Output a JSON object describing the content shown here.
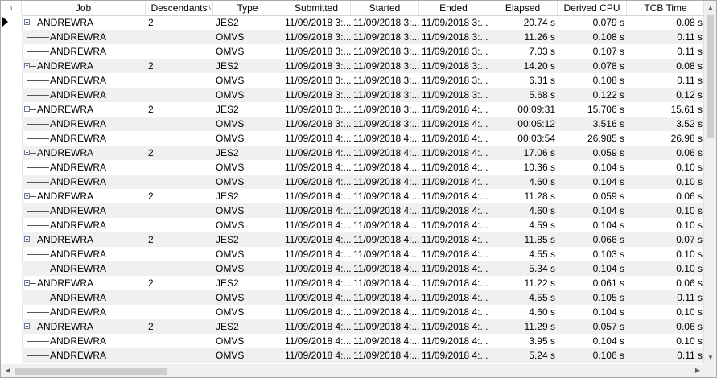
{
  "columns": [
    {
      "key": "pin",
      "label": "",
      "w": 26
    },
    {
      "key": "job",
      "label": "Job",
      "w": 154
    },
    {
      "key": "desc",
      "label": "Descendants",
      "w": 84
    },
    {
      "key": "type",
      "label": "Type",
      "w": 86
    },
    {
      "key": "submitted",
      "label": "Submitted",
      "w": 85
    },
    {
      "key": "started",
      "label": "Started",
      "w": 85
    },
    {
      "key": "ended",
      "label": "Ended",
      "w": 86
    },
    {
      "key": "elapsed",
      "label": "Elapsed",
      "w": 86
    },
    {
      "key": "cpu",
      "label": "Derived CPU",
      "w": 86
    },
    {
      "key": "tcb",
      "label": "TCB Time",
      "w": 97
    }
  ],
  "header_sort_indicator": "\\",
  "header_pin_glyph": "ᵖ",
  "rows": [
    {
      "level": 0,
      "job": "ANDREWRA",
      "desc": "2",
      "type": "JES2",
      "submitted": "11/09/2018  3:...",
      "started": "11/09/2018  3:...",
      "ended": "11/09/2018  3:...",
      "elapsed": "20.74 s",
      "cpu": "0.079 s",
      "tcb": "0.08 s"
    },
    {
      "level": 1,
      "job": "ANDREWRA",
      "desc": "",
      "type": "OMVS",
      "submitted": "11/09/2018  3:...",
      "started": "11/09/2018  3:...",
      "ended": "11/09/2018  3:...",
      "elapsed": "11.26 s",
      "cpu": "0.108 s",
      "tcb": "0.11 s"
    },
    {
      "level": 2,
      "job": "ANDREWRA",
      "desc": "",
      "type": "OMVS",
      "submitted": "11/09/2018  3:...",
      "started": "11/09/2018  3:...",
      "ended": "11/09/2018  3:...",
      "elapsed": "7.03 s",
      "cpu": "0.107 s",
      "tcb": "0.11 s"
    },
    {
      "level": 0,
      "job": "ANDREWRA",
      "desc": "2",
      "type": "JES2",
      "submitted": "11/09/2018  3:...",
      "started": "11/09/2018  3:...",
      "ended": "11/09/2018  3:...",
      "elapsed": "14.20 s",
      "cpu": "0.078 s",
      "tcb": "0.08 s"
    },
    {
      "level": 1,
      "job": "ANDREWRA",
      "desc": "",
      "type": "OMVS",
      "submitted": "11/09/2018  3:...",
      "started": "11/09/2018  3:...",
      "ended": "11/09/2018  3:...",
      "elapsed": "6.31 s",
      "cpu": "0.108 s",
      "tcb": "0.11 s"
    },
    {
      "level": 2,
      "job": "ANDREWRA",
      "desc": "",
      "type": "OMVS",
      "submitted": "11/09/2018  3:...",
      "started": "11/09/2018  3:...",
      "ended": "11/09/2018  3:...",
      "elapsed": "5.68 s",
      "cpu": "0.122 s",
      "tcb": "0.12 s"
    },
    {
      "level": 0,
      "job": "ANDREWRA",
      "desc": "2",
      "type": "JES2",
      "submitted": "11/09/2018  3:...",
      "started": "11/09/2018  3:...",
      "ended": "11/09/2018  4:...",
      "elapsed": "00:09:31",
      "cpu": "15.706 s",
      "tcb": "15.61 s"
    },
    {
      "level": 1,
      "job": "ANDREWRA",
      "desc": "",
      "type": "OMVS",
      "submitted": "11/09/2018  3:...",
      "started": "11/09/2018  3:...",
      "ended": "11/09/2018  4:...",
      "elapsed": "00:05:12",
      "cpu": "3.516 s",
      "tcb": "3.52 s"
    },
    {
      "level": 2,
      "job": "ANDREWRA",
      "desc": "",
      "type": "OMVS",
      "submitted": "11/09/2018  4:...",
      "started": "11/09/2018  4:...",
      "ended": "11/09/2018  4:...",
      "elapsed": "00:03:54",
      "cpu": "26.985 s",
      "tcb": "26.98 s"
    },
    {
      "level": 0,
      "job": "ANDREWRA",
      "desc": "2",
      "type": "JES2",
      "submitted": "11/09/2018  4:...",
      "started": "11/09/2018  4:...",
      "ended": "11/09/2018  4:...",
      "elapsed": "17.06 s",
      "cpu": "0.059 s",
      "tcb": "0.06 s"
    },
    {
      "level": 1,
      "job": "ANDREWRA",
      "desc": "",
      "type": "OMVS",
      "submitted": "11/09/2018  4:...",
      "started": "11/09/2018  4:...",
      "ended": "11/09/2018  4:...",
      "elapsed": "10.36 s",
      "cpu": "0.104 s",
      "tcb": "0.10 s"
    },
    {
      "level": 2,
      "job": "ANDREWRA",
      "desc": "",
      "type": "OMVS",
      "submitted": "11/09/2018  4:...",
      "started": "11/09/2018  4:...",
      "ended": "11/09/2018  4:...",
      "elapsed": "4.60 s",
      "cpu": "0.104 s",
      "tcb": "0.10 s"
    },
    {
      "level": 0,
      "job": "ANDREWRA",
      "desc": "2",
      "type": "JES2",
      "submitted": "11/09/2018  4:...",
      "started": "11/09/2018  4:...",
      "ended": "11/09/2018  4:...",
      "elapsed": "11.28 s",
      "cpu": "0.059 s",
      "tcb": "0.06 s"
    },
    {
      "level": 1,
      "job": "ANDREWRA",
      "desc": "",
      "type": "OMVS",
      "submitted": "11/09/2018  4:...",
      "started": "11/09/2018  4:...",
      "ended": "11/09/2018  4:...",
      "elapsed": "4.60 s",
      "cpu": "0.104 s",
      "tcb": "0.10 s"
    },
    {
      "level": 2,
      "job": "ANDREWRA",
      "desc": "",
      "type": "OMVS",
      "submitted": "11/09/2018  4:...",
      "started": "11/09/2018  4:...",
      "ended": "11/09/2018  4:...",
      "elapsed": "4.59 s",
      "cpu": "0.104 s",
      "tcb": "0.10 s"
    },
    {
      "level": 0,
      "job": "ANDREWRA",
      "desc": "2",
      "type": "JES2",
      "submitted": "11/09/2018  4:...",
      "started": "11/09/2018  4:...",
      "ended": "11/09/2018  4:...",
      "elapsed": "11.85 s",
      "cpu": "0.066 s",
      "tcb": "0.07 s"
    },
    {
      "level": 1,
      "job": "ANDREWRA",
      "desc": "",
      "type": "OMVS",
      "submitted": "11/09/2018  4:...",
      "started": "11/09/2018  4:...",
      "ended": "11/09/2018  4:...",
      "elapsed": "4.55 s",
      "cpu": "0.103 s",
      "tcb": "0.10 s"
    },
    {
      "level": 2,
      "job": "ANDREWRA",
      "desc": "",
      "type": "OMVS",
      "submitted": "11/09/2018  4:...",
      "started": "11/09/2018  4:...",
      "ended": "11/09/2018  4:...",
      "elapsed": "5.34 s",
      "cpu": "0.104 s",
      "tcb": "0.10 s"
    },
    {
      "level": 0,
      "job": "ANDREWRA",
      "desc": "2",
      "type": "JES2",
      "submitted": "11/09/2018  4:...",
      "started": "11/09/2018  4:...",
      "ended": "11/09/2018  4:...",
      "elapsed": "11.22 s",
      "cpu": "0.061 s",
      "tcb": "0.06 s"
    },
    {
      "level": 1,
      "job": "ANDREWRA",
      "desc": "",
      "type": "OMVS",
      "submitted": "11/09/2018  4:...",
      "started": "11/09/2018  4:...",
      "ended": "11/09/2018  4:...",
      "elapsed": "4.55 s",
      "cpu": "0.105 s",
      "tcb": "0.11 s"
    },
    {
      "level": 2,
      "job": "ANDREWRA",
      "desc": "",
      "type": "OMVS",
      "submitted": "11/09/2018  4:...",
      "started": "11/09/2018  4:...",
      "ended": "11/09/2018  4:...",
      "elapsed": "4.60 s",
      "cpu": "0.104 s",
      "tcb": "0.10 s"
    },
    {
      "level": 0,
      "job": "ANDREWRA",
      "desc": "2",
      "type": "JES2",
      "submitted": "11/09/2018  4:...",
      "started": "11/09/2018  4:...",
      "ended": "11/09/2018  4:...",
      "elapsed": "11.29 s",
      "cpu": "0.057 s",
      "tcb": "0.06 s"
    },
    {
      "level": 1,
      "job": "ANDREWRA",
      "desc": "",
      "type": "OMVS",
      "submitted": "11/09/2018  4:...",
      "started": "11/09/2018  4:...",
      "ended": "11/09/2018  4:...",
      "elapsed": "3.95 s",
      "cpu": "0.104 s",
      "tcb": "0.10 s"
    },
    {
      "level": 2,
      "job": "ANDREWRA",
      "desc": "",
      "type": "OMVS",
      "submitted": "11/09/2018  4:...",
      "started": "11/09/2018  4:...",
      "ended": "11/09/2018  4:...",
      "elapsed": "5.24 s",
      "cpu": "0.106 s",
      "tcb": "0.11 s"
    }
  ],
  "icons": {
    "expand": "tree-collapse-icon",
    "current_row": "current-row-arrow-icon",
    "scroll_up": "▲",
    "scroll_down": "▼",
    "scroll_left": "◀",
    "scroll_right": "▶"
  }
}
